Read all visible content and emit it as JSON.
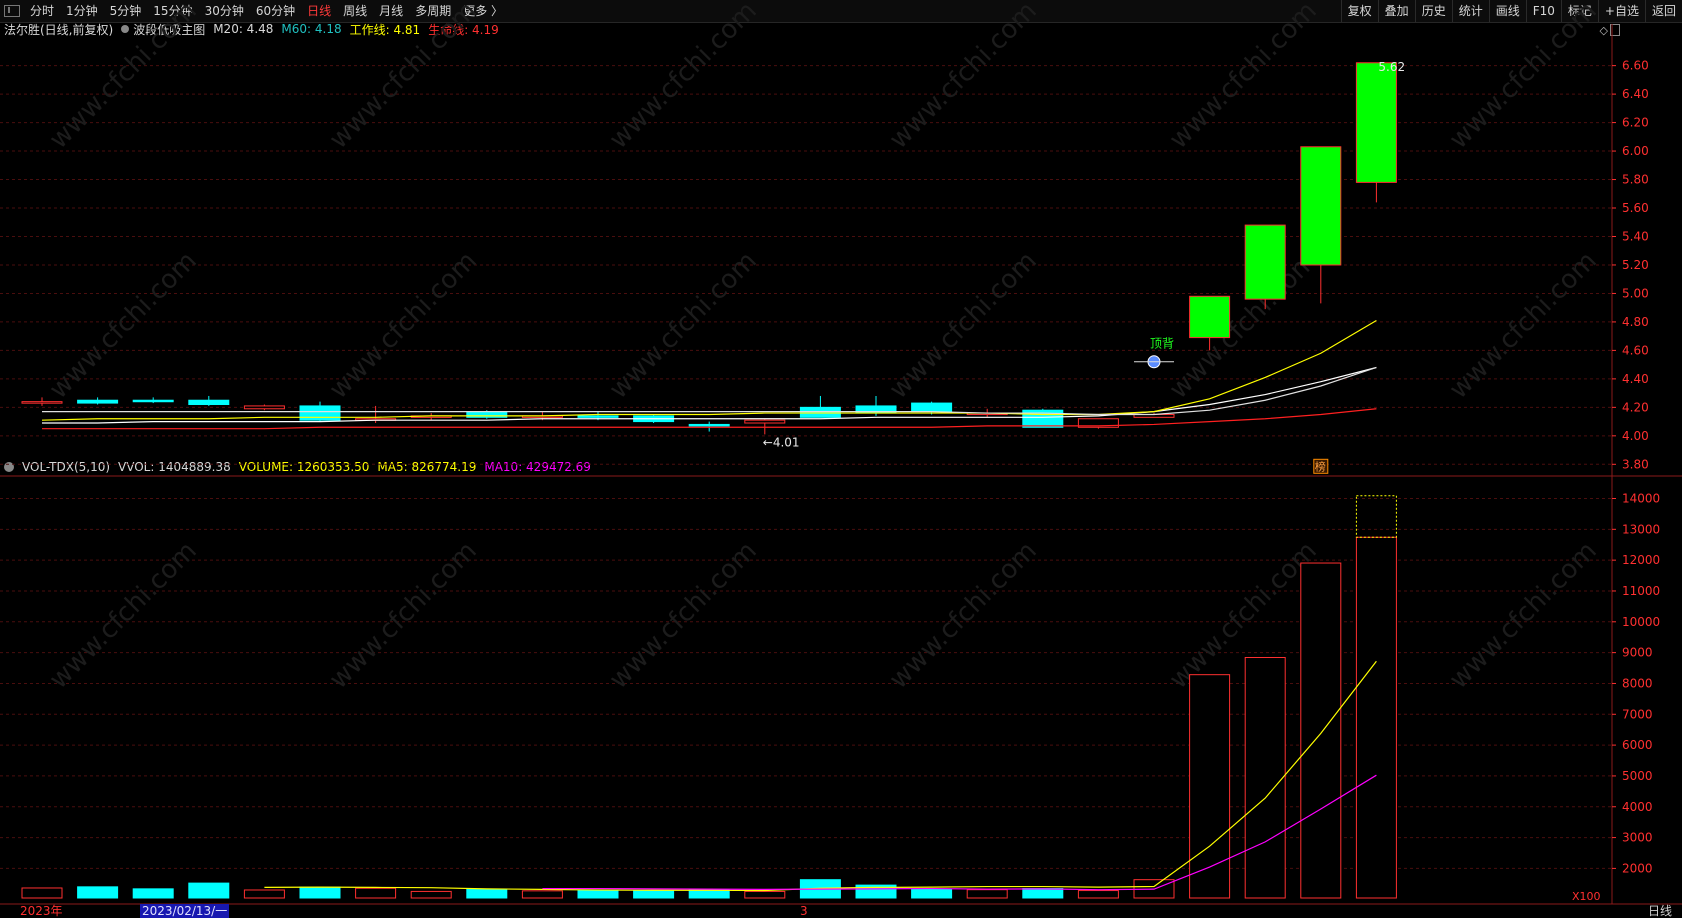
{
  "toolbar": {
    "left_items": [
      "分时",
      "1分钟",
      "5分钟",
      "15分钟",
      "30分钟",
      "60分钟",
      "日线",
      "周线",
      "月线",
      "多周期",
      "更多 〉"
    ],
    "active": "日线",
    "right_items": [
      "复权",
      "叠加",
      "历史",
      "统计",
      "画线",
      "F10",
      "标记",
      "+自选",
      "返回"
    ]
  },
  "main_info": {
    "stock": "法尔胜(日线,前复权)",
    "indicator": "波段低吸主图",
    "m20": "M20: 4.48",
    "m60": "M60: 4.18",
    "work_line": "工作线: 4.81",
    "life_line": "生命线: 4.19"
  },
  "vol_info": {
    "name": "VOL-TDX(5,10)",
    "vvol": "VVOL: 1404889.38",
    "volume": "VOLUME: 1260353.50",
    "ma5": "MA5: 826774.19",
    "ma10": "MA10: 429472.69"
  },
  "annotations": {
    "high_label": "5.62",
    "low_label": "←4.01",
    "signal_label": "顶背",
    "marker_label": "榜",
    "vol_unit": "X100"
  },
  "watermark": "www.cfchi.com",
  "status": {
    "year": "2023年",
    "date": "2023/02/13/一",
    "month_mark": "3",
    "period": "日线"
  },
  "chart_data": [
    {
      "type": "candlestick",
      "title": "法尔胜(日线,前复权)",
      "y_ticks": [
        "6.60",
        "6.40",
        "6.20",
        "6.00",
        "5.80",
        "5.60",
        "5.40",
        "5.20",
        "5.00",
        "4.80",
        "4.60",
        "4.40",
        "4.20",
        "4.00",
        "3.80"
      ],
      "ylim": [
        3.76,
        6.78
      ],
      "candles": [
        {
          "o": 4.24,
          "h": 4.27,
          "l": 4.21,
          "c": 4.24
        },
        {
          "o": 4.25,
          "h": 4.27,
          "l": 4.22,
          "c": 4.23
        },
        {
          "o": 4.25,
          "h": 4.27,
          "l": 4.23,
          "c": 4.24
        },
        {
          "o": 4.25,
          "h": 4.28,
          "l": 4.21,
          "c": 4.22
        },
        {
          "o": 4.19,
          "h": 4.22,
          "l": 4.18,
          "c": 4.21
        },
        {
          "o": 4.21,
          "h": 4.24,
          "l": 4.1,
          "c": 4.11
        },
        {
          "o": 4.11,
          "h": 4.21,
          "l": 4.09,
          "c": 4.12
        },
        {
          "o": 4.13,
          "h": 4.16,
          "l": 4.11,
          "c": 4.14
        },
        {
          "o": 4.17,
          "h": 4.18,
          "l": 4.12,
          "c": 4.13
        },
        {
          "o": 4.14,
          "h": 4.17,
          "l": 4.11,
          "c": 4.14
        },
        {
          "o": 4.14,
          "h": 4.17,
          "l": 4.11,
          "c": 4.13
        },
        {
          "o": 4.14,
          "h": 4.15,
          "l": 4.09,
          "c": 4.1
        },
        {
          "o": 4.08,
          "h": 4.1,
          "l": 4.03,
          "c": 4.07
        },
        {
          "o": 4.09,
          "h": 4.12,
          "l": 4.01,
          "c": 4.11
        },
        {
          "o": 4.2,
          "h": 4.28,
          "l": 4.13,
          "c": 4.13
        },
        {
          "o": 4.21,
          "h": 4.28,
          "l": 4.14,
          "c": 4.16
        },
        {
          "o": 4.23,
          "h": 4.24,
          "l": 4.15,
          "c": 4.17
        },
        {
          "o": 4.16,
          "h": 4.19,
          "l": 4.13,
          "c": 4.16
        },
        {
          "o": 4.18,
          "h": 4.19,
          "l": 4.06,
          "c": 4.06
        },
        {
          "o": 4.06,
          "h": 4.12,
          "l": 4.05,
          "c": 4.12
        },
        {
          "o": 4.13,
          "h": 4.16,
          "l": 4.13,
          "c": 4.15
        },
        {
          "o": 4.69,
          "h": 4.98,
          "l": 4.6,
          "c": 4.98
        },
        {
          "o": 4.96,
          "h": 5.48,
          "l": 4.89,
          "c": 5.48
        },
        {
          "o": 5.2,
          "h": 6.03,
          "l": 4.93,
          "c": 6.03
        },
        {
          "o": 5.78,
          "h": 6.62,
          "l": 5.64,
          "c": 6.62
        }
      ],
      "series": [
        {
          "name": "M20",
          "color": "#ffffff",
          "values": [
            4.09,
            4.09,
            4.1,
            4.1,
            4.1,
            4.1,
            4.11,
            4.11,
            4.11,
            4.12,
            4.12,
            4.12,
            4.12,
            4.12,
            4.12,
            4.13,
            4.13,
            4.13,
            4.13,
            4.14,
            4.17,
            4.22,
            4.29,
            4.38,
            4.48
          ]
        },
        {
          "name": "M60",
          "color": "#ff2020",
          "values": [
            4.05,
            4.05,
            4.05,
            4.05,
            4.05,
            4.06,
            4.06,
            4.06,
            4.06,
            4.06,
            4.06,
            4.06,
            4.06,
            4.06,
            4.06,
            4.06,
            4.06,
            4.07,
            4.07,
            4.07,
            4.08,
            4.1,
            4.12,
            4.15,
            4.19
          ]
        },
        {
          "name": "工作线",
          "color": "#ffff00",
          "values": [
            4.11,
            4.12,
            4.12,
            4.12,
            4.13,
            4.13,
            4.13,
            4.14,
            4.14,
            4.14,
            4.15,
            4.15,
            4.15,
            4.16,
            4.16,
            4.16,
            4.16,
            4.16,
            4.15,
            4.15,
            4.17,
            4.26,
            4.41,
            4.58,
            4.81
          ]
        },
        {
          "name": "生命线",
          "color": "#e0e0e0",
          "values": [
            4.17,
            4.17,
            4.17,
            4.17,
            4.17,
            4.17,
            4.17,
            4.17,
            4.17,
            4.17,
            4.17,
            4.17,
            4.17,
            4.17,
            4.17,
            4.17,
            4.17,
            4.16,
            4.16,
            4.15,
            4.15,
            4.18,
            4.25,
            4.35,
            4.48
          ]
        }
      ]
    },
    {
      "type": "bar",
      "title": "VOL-TDX(5,10)",
      "y_ticks": [
        "14000",
        "13000",
        "12000",
        "11000",
        "10000",
        "9000",
        "8000",
        "7000",
        "6000",
        "5000",
        "4000",
        "3000",
        "2000"
      ],
      "ylim": [
        1040,
        14600
      ],
      "unit": "X100",
      "volumes": [
        350,
        390,
        320,
        520,
        280,
        380,
        340,
        230,
        300,
        250,
        270,
        260,
        290,
        230,
        640,
        450,
        300,
        290,
        330,
        260,
        640,
        7800,
        8400,
        11700,
        12600
      ],
      "vvol": 14049,
      "series": [
        {
          "name": "MA5",
          "color": "#ffff00",
          "values": [
            null,
            null,
            null,
            null,
            370,
            380,
            370,
            360,
            320,
            300,
            280,
            270,
            270,
            260,
            340,
            370,
            380,
            400,
            400,
            380,
            400,
            1810,
            3490,
            5750,
            8270
          ]
        },
        {
          "name": "MA10",
          "color": "#ff00ff",
          "values": [
            null,
            null,
            null,
            null,
            null,
            null,
            null,
            null,
            null,
            330,
            330,
            320,
            310,
            300,
            310,
            320,
            330,
            310,
            320,
            290,
            310,
            1080,
            1960,
            3110,
            4290
          ]
        }
      ]
    }
  ]
}
